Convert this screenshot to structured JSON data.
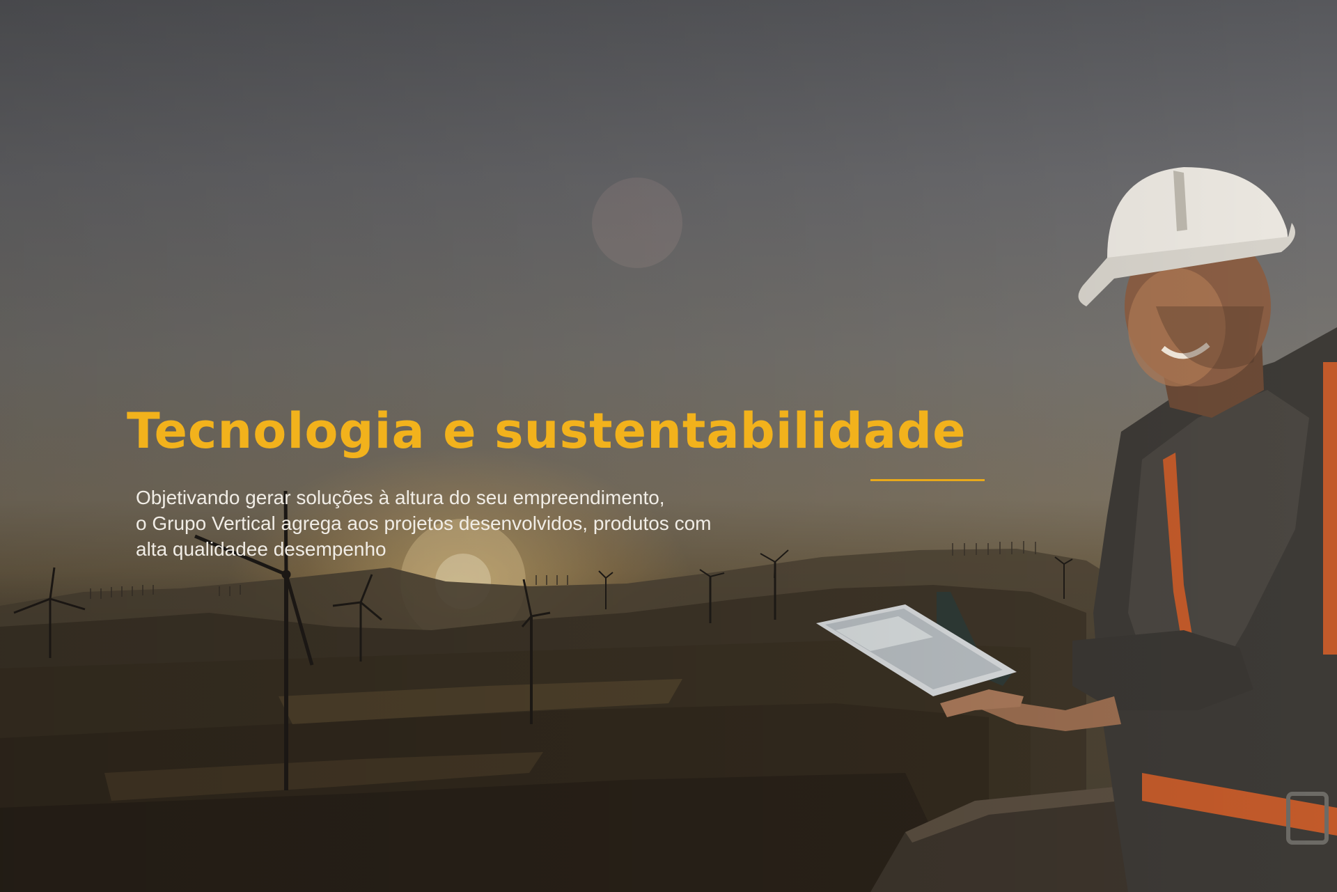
{
  "hero": {
    "title": "Tecnologia e sustentabilidade",
    "description_lines": [
      "Objetivando gerar soluções à altura do seu empreendimento,",
      "o Grupo Vertical agrega aos projetos desenvolvidos, produtos com",
      "alta qualidadee desempenho"
    ]
  },
  "colors": {
    "accent": "#f2b21c",
    "text": "#f1ede6"
  },
  "icons": [
    "wind-turbine-icon",
    "worker-photo",
    "tablet-device"
  ]
}
